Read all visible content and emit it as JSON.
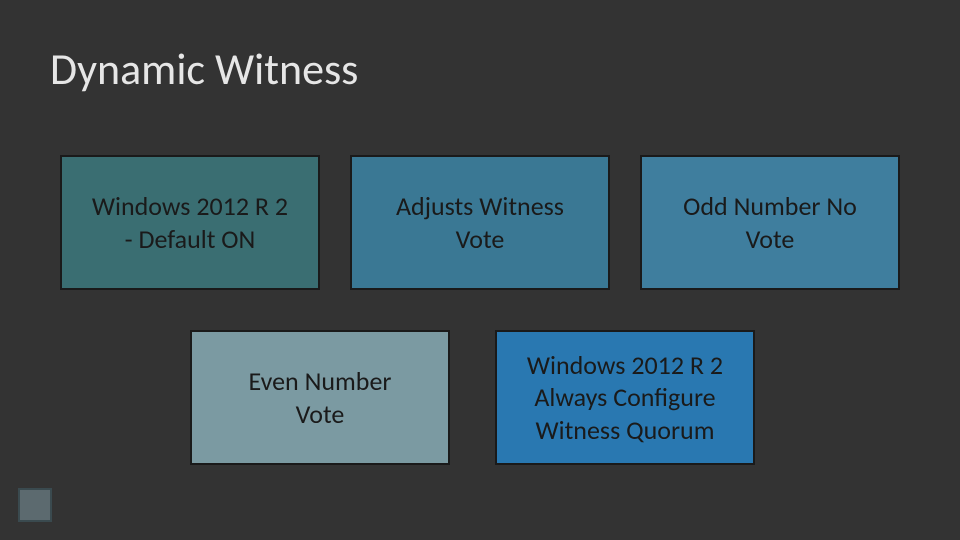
{
  "title": "Dynamic Witness",
  "boxes": {
    "b1": {
      "line1": "Windows 2012 R 2",
      "line2": "- Default ON"
    },
    "b2": {
      "line1": "Adjusts Witness",
      "line2": "Vote"
    },
    "b3": {
      "line1": "Odd Number No",
      "line2": "Vote"
    },
    "b4": {
      "line1": "Even Number",
      "line2": "Vote"
    },
    "b5": {
      "line1": "Windows 2012 R 2",
      "line2": "Always Configure",
      "line3": "Witness Quorum"
    }
  },
  "logo": ""
}
